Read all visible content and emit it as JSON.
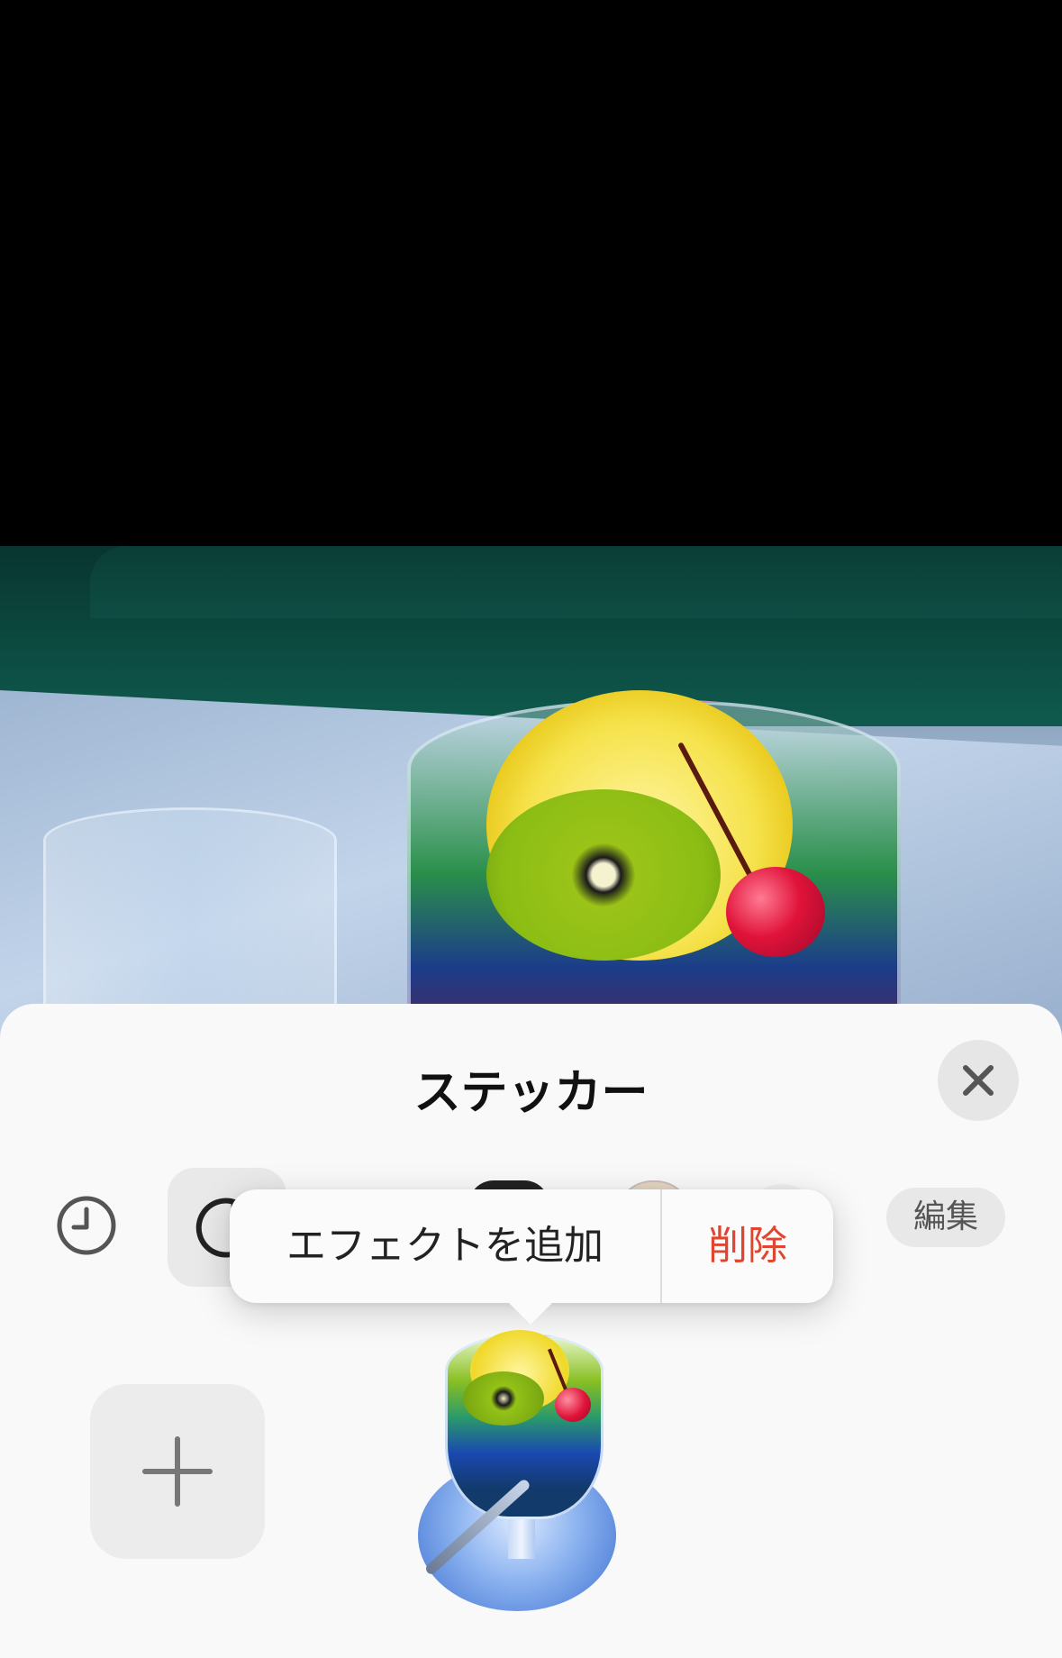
{
  "sheet": {
    "title": "ステッカー",
    "close_icon": "close-icon",
    "tabs": [
      {
        "icon": "clock-icon",
        "label": "recent"
      },
      {
        "icon": "sticker-icon",
        "label": "stickers",
        "selected": true
      },
      {
        "icon": "sticker-pack-icon",
        "label": "pack-dark"
      },
      {
        "icon": "emoji-icon",
        "label": "emoji"
      },
      {
        "icon": "sticker-pack-icon",
        "label": "pack-other"
      }
    ],
    "edit_label": "編集",
    "add_icon": "plus-icon"
  },
  "context_menu": {
    "add_effect_label": "エフェクトを追加",
    "delete_label": "削除",
    "delete_color": "#e0452f"
  }
}
